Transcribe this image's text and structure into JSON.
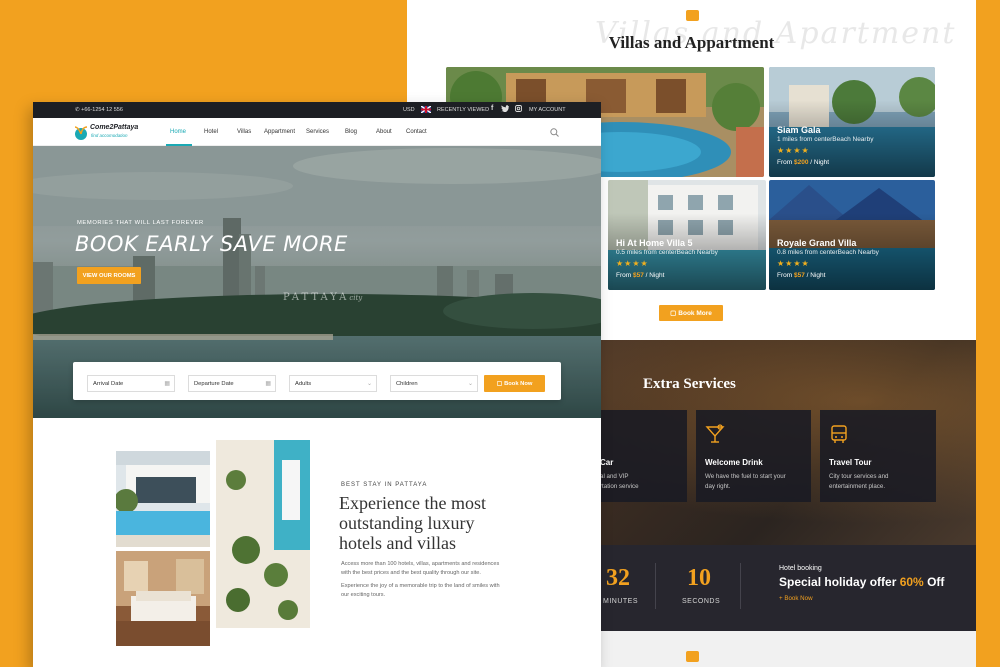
{
  "back": {
    "villas_title": "Villas and Appartment",
    "script_overlay": "Villas and Apartment",
    "villas": [
      {
        "name": "",
        "distance": "",
        "price": "",
        "per": ""
      },
      {
        "name": "Siam Gala",
        "distance": "1 miles from centerBeach Nearby",
        "price": "$200",
        "per": " / Night",
        "price_prefix": "From "
      },
      {
        "name": "Hi At Home Villa 5",
        "distance": "0.5 miles from centerBeach Nearby",
        "price": "$57",
        "per": " / Night",
        "price_prefix": "From "
      },
      {
        "name": "Royale Grand Villa",
        "distance": "0.8 miles from centerBeach Nearby",
        "price": "$57",
        "per": " / Night",
        "price_prefix": "From "
      }
    ],
    "stars": "★★★★",
    "book_more": "Book More",
    "services_title": "Extra Services",
    "services": [
      {
        "title": "Car",
        "desc_1": "al and VIP",
        "desc_2": "rtation service"
      },
      {
        "title": "Welcome Drink",
        "desc_1": "We have the fuel to start your",
        "desc_2": "day right."
      },
      {
        "title": "Travel Tour",
        "desc_1": "City tour services and",
        "desc_2": "entertainment place."
      }
    ],
    "countdown": [
      {
        "value": "32",
        "label": "MINUTES"
      },
      {
        "value": "10",
        "label": "SECONDS"
      }
    ],
    "offer": {
      "kicker": "Hotel booking",
      "text_prefix": "Special holiday offer ",
      "percent": "60%",
      "text_suffix": " Off",
      "link": "+ Book Now"
    }
  },
  "front": {
    "topbar": {
      "phone": "+66-1254 12 556",
      "currency": "USD",
      "recently_viewed": "RECENTLY VIEWED",
      "account": "MY ACCOUNT"
    },
    "logo": {
      "name": "Come2Pattaya",
      "tagline": "find accomodation"
    },
    "nav": [
      "Home",
      "Hotel",
      "Villas",
      "Appartment",
      "Services",
      "Blog",
      "About",
      "Contact"
    ],
    "hero": {
      "tagline": "MEMORIES THAT WILL LAST FOREVER",
      "title": "BOOK EARLY SAVE MORE",
      "cta": "VIEW OUR ROOMS",
      "city_label": "PATTAYA",
      "city_script": "city"
    },
    "booking": {
      "arrival": "Arrival Date",
      "departure": "Departure Date",
      "adults": "Adults",
      "children": "Children",
      "submit": "Book Now"
    },
    "intro": {
      "kicker": "BEST STAY IN PATTAYA",
      "title_1": "Experience the most",
      "title_2": "outstanding luxury",
      "title_3": "hotels and villas",
      "para1_1": "Access more than 100 hotels, villas, apartments and residences",
      "para1_2": "with the best prices and the best quality through our site.",
      "para2_1": "Experience the joy of a memorable trip to the land of smiles with",
      "para2_2": "our exciting tours."
    }
  },
  "colors": {
    "accent": "#f2a11f",
    "nav_active": "#1aa9b4",
    "dark": "#1d1f24"
  }
}
